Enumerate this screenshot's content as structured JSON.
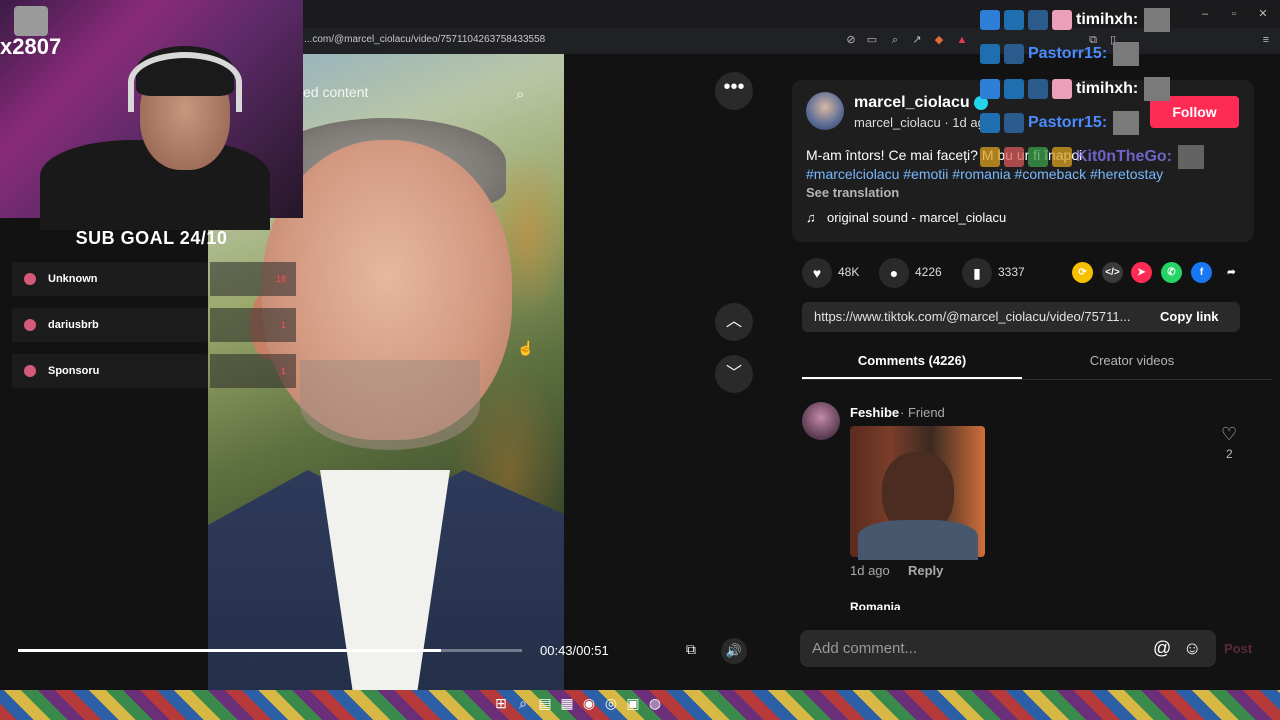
{
  "browser": {
    "url": "...com/@marcel_ciolacu/video/7571104263758433558"
  },
  "video": {
    "overlay_label": "ed content",
    "time": "00:43/00:51",
    "progress_fraction": 0.84
  },
  "stream": {
    "sub_count": "x2807",
    "sub_goal": "SUB GOAL 24/10",
    "donors": [
      {
        "name": "Unknown",
        "amount": "18"
      },
      {
        "name": "dariusbrb",
        "amount": "1"
      },
      {
        "name": "Sponsoru",
        "amount": "1"
      }
    ]
  },
  "post": {
    "author_name": "marcel_ciolacu",
    "author_handle": "marcel_ciolacu",
    "author_time": "1d ag",
    "follow_label": "Follow",
    "caption": "M-am întors! Ce mai faceți? M bu ur fi înapoi",
    "hashtags": "#marcelciolacu #emotii #romania #comeback #heretostay",
    "see_translation": "See translation",
    "music": "original sound - marcel_ciolacu",
    "likes": "48K",
    "comments": "4226",
    "saves": "3337",
    "link": "https://www.tiktok.com/@marcel_ciolacu/video/75711...",
    "copy_link": "Copy link"
  },
  "tabs": {
    "comments": "Comments (4226)",
    "creator": "Creator videos"
  },
  "comment": {
    "user": "Feshibe",
    "tag": "· Friend",
    "time": "1d ago",
    "reply": "Reply",
    "likes": "2",
    "next_user": "Romania"
  },
  "input": {
    "placeholder": "Add comment...",
    "post": "Post"
  },
  "chat": [
    {
      "name": "timihxh:",
      "color": "#ffffff"
    },
    {
      "name": "Pastorr15:",
      "color": "#4a8cff"
    },
    {
      "name": "timihxh:",
      "color": "#ffffff"
    },
    {
      "name": "Pastorr15:",
      "color": "#4a8cff"
    },
    {
      "name": "Kit0nTheGo:",
      "color": "#8a7cff"
    }
  ],
  "colors": {
    "follow": "#fe2c55",
    "hashtag": "#7ab8ff"
  }
}
